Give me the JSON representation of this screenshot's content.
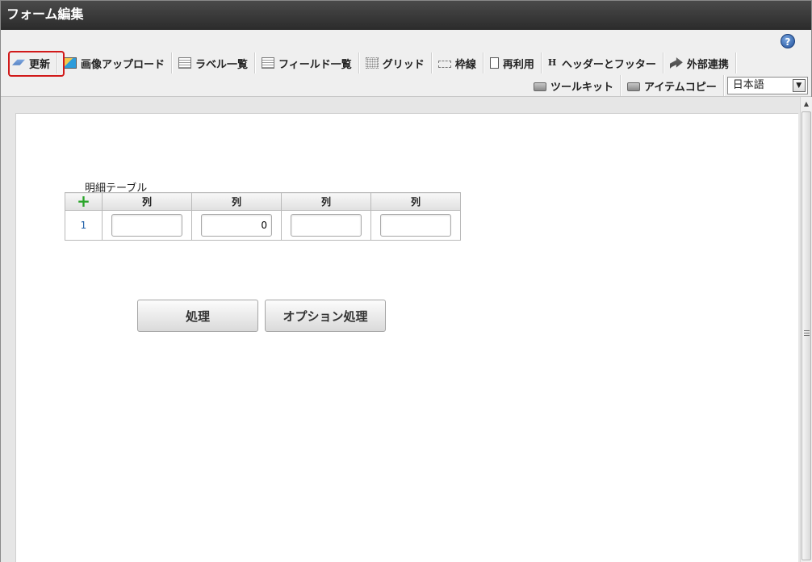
{
  "window": {
    "title": "フォーム編集"
  },
  "toolbar": {
    "row1": [
      {
        "label": "更新",
        "icon": "update-icon"
      },
      {
        "label": "画像アップロード",
        "icon": "image-upload-icon"
      },
      {
        "label": "ラベル一覧",
        "icon": "label-list-icon"
      },
      {
        "label": "フィールド一覧",
        "icon": "field-list-icon"
      },
      {
        "label": "グリッド",
        "icon": "grid-icon"
      },
      {
        "label": "枠線",
        "icon": "frame-line-icon"
      },
      {
        "label": "再利用",
        "icon": "reuse-icon"
      },
      {
        "label": "ヘッダーとフッター",
        "icon": "header-footer-icon"
      },
      {
        "label": "外部連携",
        "icon": "external-link-icon"
      }
    ],
    "row2": [
      {
        "label": "ツールキット",
        "icon": "toolkit-icon"
      },
      {
        "label": "アイテムコピー",
        "icon": "item-copy-icon"
      }
    ],
    "language": "日本語",
    "help_glyph": "?",
    "h_glyph": "H"
  },
  "highlight_color": "#d11a1a",
  "form": {
    "table_label": "明細テーブル",
    "add_glyph": "+",
    "columns": [
      "列",
      "列",
      "列",
      "列"
    ],
    "rows": [
      {
        "num": "1",
        "values": [
          "",
          "0",
          "",
          ""
        ]
      }
    ],
    "buttons": {
      "process": "処理",
      "option_process": "オプション処理"
    }
  }
}
